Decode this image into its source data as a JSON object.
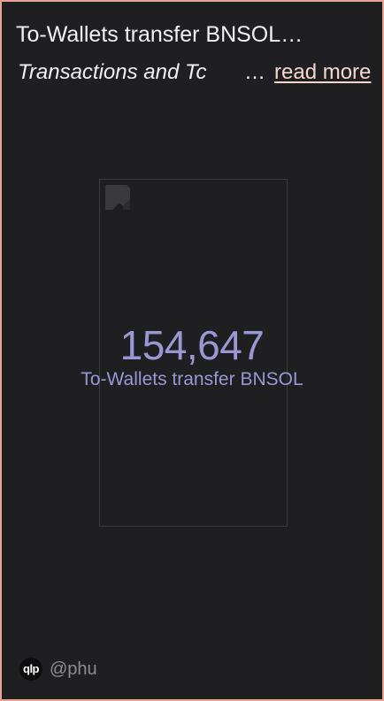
{
  "card": {
    "title": "To-Wallets transfer BNSOL…",
    "subtitle": "Transactions and Tc",
    "ellipsis": "…",
    "read_more": "read more"
  },
  "metric": {
    "value": "154,647",
    "label": "To-Wallets transfer BNSOL"
  },
  "footer": {
    "avatar_text": "qlp",
    "handle": "@phu"
  },
  "colors": {
    "background": "#1f1f21",
    "border": "#e7a394",
    "metric": "#9a97d4",
    "read_more": "#f5d7cf"
  }
}
